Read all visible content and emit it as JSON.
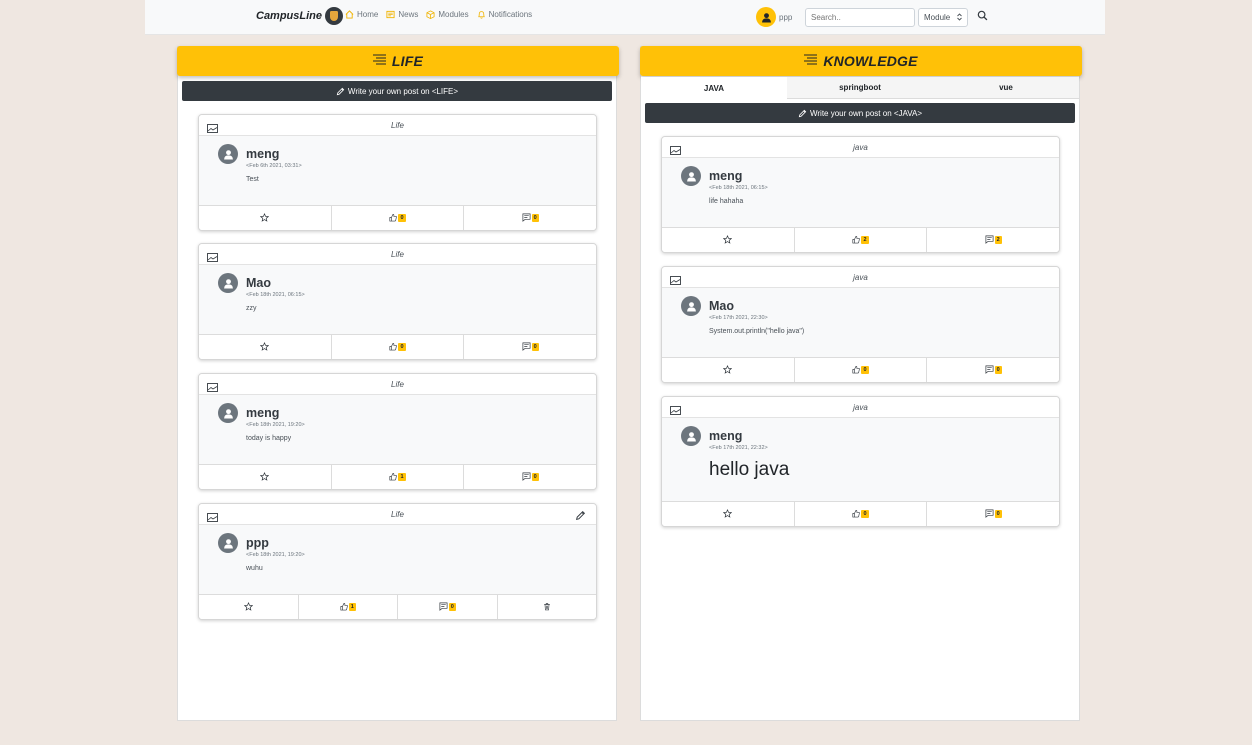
{
  "navbar": {
    "brand": "CampusLine",
    "links": [
      {
        "label": "Home",
        "icon": "home-icon"
      },
      {
        "label": "News",
        "icon": "newspaper-icon"
      },
      {
        "label": "Modules",
        "icon": "box-icon"
      },
      {
        "label": "Notifications",
        "icon": "bell-icon"
      }
    ],
    "username": "ppp",
    "search_placeholder": "Search..",
    "module_select": "Module"
  },
  "colors": {
    "accent": "#ffc107",
    "dark": "#343a40",
    "background": "#efe7e1"
  },
  "left_panel": {
    "title": "LIFE",
    "write_label": "Write your own post on <LIFE>",
    "posts": [
      {
        "module": "Life",
        "author": "meng",
        "date": "<Feb 6th 2021, 03:31>",
        "content": "Test",
        "likes": "0",
        "comments": "0"
      },
      {
        "module": "Life",
        "author": "Mao",
        "date": "<Feb 18th 2021, 06:15>",
        "content": "zzy",
        "likes": "0",
        "comments": "0"
      },
      {
        "module": "Life",
        "author": "meng",
        "date": "<Feb 18th 2021, 19:20>",
        "content": "today is happy",
        "likes": "1",
        "comments": "0"
      },
      {
        "module": "Life",
        "author": "ppp",
        "date": "<Feb 18th 2021, 19:20>",
        "content": "wuhu",
        "likes": "1",
        "comments": "0"
      }
    ]
  },
  "right_panel": {
    "title": "KNOWLEDGE",
    "tabs": [
      "JAVA",
      "springboot",
      "vue"
    ],
    "active_tab": "JAVA",
    "write_label": "Write your own post on <JAVA>",
    "posts": [
      {
        "module": "java",
        "author": "meng",
        "date": "<Feb 18th 2021, 06:15>",
        "content": "life hahaha",
        "likes": "2",
        "comments": "2"
      },
      {
        "module": "java",
        "author": "Mao",
        "date": "<Feb 17th 2021, 22:30>",
        "content": "System.out.println(\"hello java\")",
        "likes": "0",
        "comments": "0"
      },
      {
        "module": "java",
        "author": "meng",
        "date": "<Feb 17th 2021, 22:32>",
        "content": "hello java",
        "likes": "0",
        "comments": "0"
      }
    ]
  }
}
